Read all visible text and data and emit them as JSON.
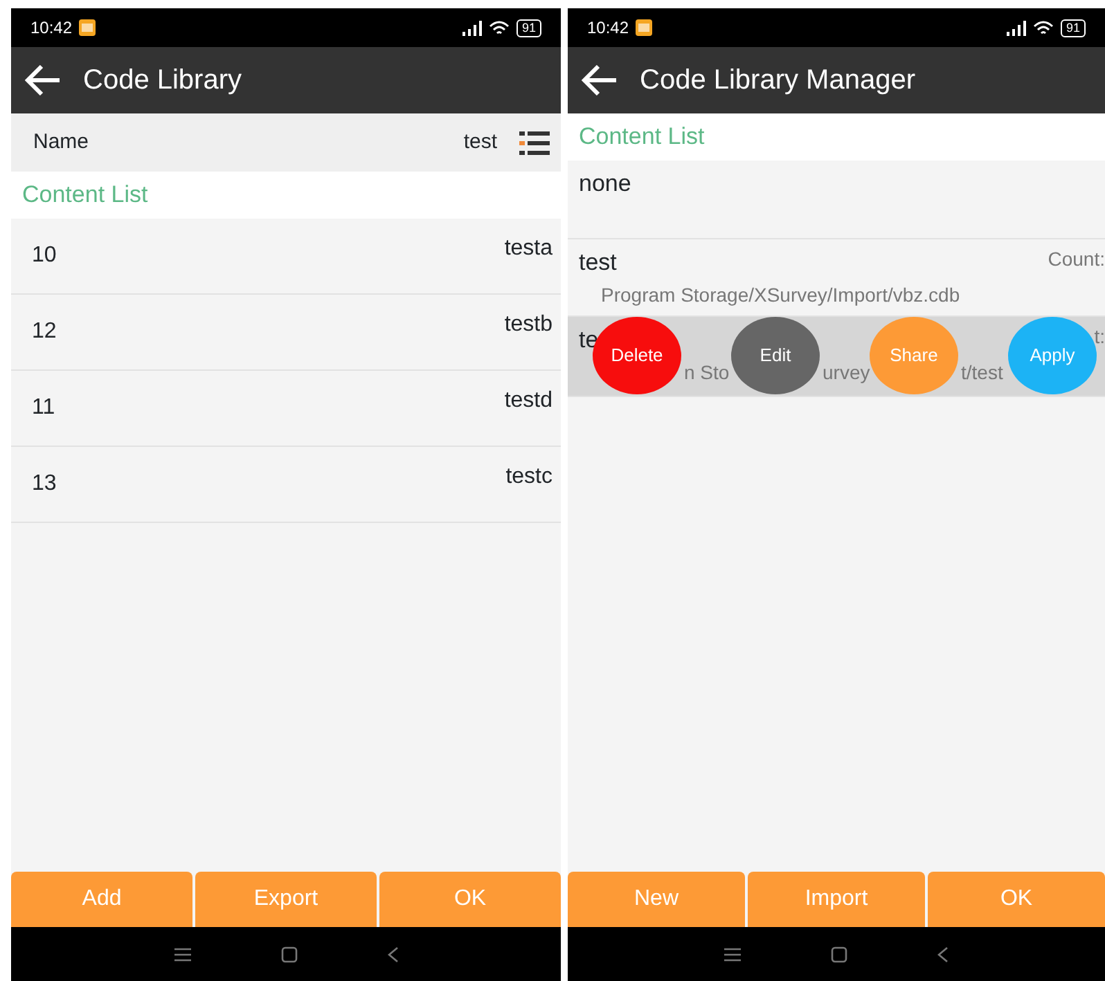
{
  "screens": [
    {
      "status_bar": {
        "time": "10:42",
        "battery": "91"
      },
      "app_bar": {
        "title": "Code Library"
      },
      "name_row": {
        "label": "Name",
        "value": "test"
      },
      "section_title": "Content List",
      "items": [
        {
          "kind": "code",
          "code": "10",
          "name": "testa"
        },
        {
          "kind": "code",
          "code": "12",
          "name": "testb"
        },
        {
          "kind": "code",
          "code": "11",
          "name": "testd"
        },
        {
          "kind": "code",
          "code": "13",
          "name": "testc"
        }
      ],
      "buttons": [
        "Add",
        "Export",
        "OK"
      ]
    },
    {
      "status_bar": {
        "time": "10:42",
        "battery": "91"
      },
      "app_bar": {
        "title": "Code Library Manager"
      },
      "section_title": "Content List",
      "items": [
        {
          "kind": "plain",
          "title": "none"
        },
        {
          "kind": "library",
          "title": "test",
          "count": "Count:",
          "path": "Program Storage/XSurvey/Import/vbz.cdb"
        },
        {
          "kind": "swiped",
          "title": "te",
          "count": "t:",
          "path_fragments": [
            "n Sto",
            "urvey",
            "t/test"
          ],
          "actions": [
            {
              "label": "Delete",
              "color": "#f70d0d"
            },
            {
              "label": "Edit",
              "color": "#666666"
            },
            {
              "label": "Share",
              "color": "#fd9a36"
            },
            {
              "label": "Apply",
              "color": "#1cb3f5"
            }
          ]
        }
      ],
      "buttons": [
        "New",
        "Import",
        "OK"
      ]
    }
  ]
}
